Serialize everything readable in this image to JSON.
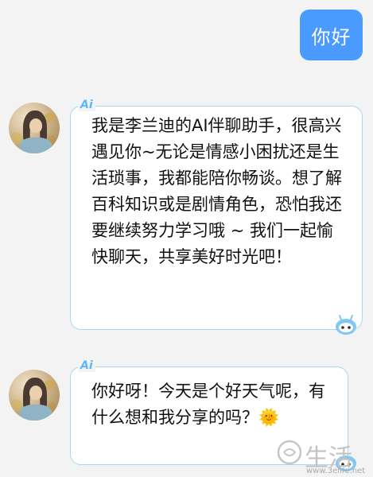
{
  "messages": {
    "user_greeting": "你好",
    "ai_tag": "Ai",
    "ai_intro": "我是李兰迪的AI伴聊助手，很高兴遇见你~无论是情感小困扰还是生活琐事，我都能陪你畅谈。想了解百科知识或是剧情角色，恐怕我还要继续努力学习哦 ~ 我们一起愉快聊天，共享美好时光吧！",
    "ai_reply": "你好呀！今天是个好天气呢，有什么想和我分享的吗？",
    "ai_reply_emoji": "🌞"
  },
  "watermark": {
    "brand": "生活",
    "url": "www.3elife.net"
  },
  "colors": {
    "user_bubble": "#4a9aff",
    "ai_border": "#a9d8ef",
    "ai_tag": "#5bb8ff"
  }
}
